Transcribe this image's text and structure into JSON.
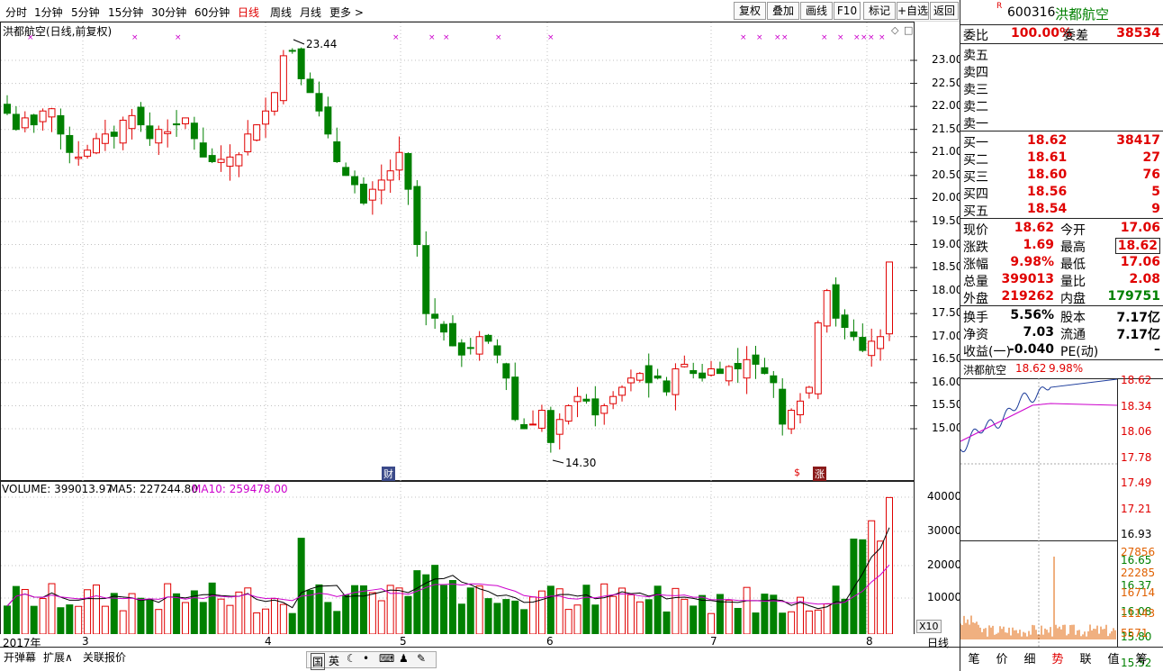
{
  "toolbar": {
    "periods": [
      "分时",
      "1分钟",
      "5分钟",
      "15分钟",
      "30分钟",
      "60分钟",
      "日线",
      "周线",
      "月线",
      "更多 >"
    ],
    "active_period": "日线",
    "buttons": [
      "复权",
      "叠加",
      "画线",
      "F10",
      "标记",
      "+自选",
      "返回"
    ]
  },
  "chart_title": "洪都航空(日线,前复权)",
  "price_axis": [
    "23.00",
    "22.50",
    "22.00",
    "21.50",
    "21.00",
    "20.50",
    "20.00",
    "19.50",
    "19.00",
    "18.50",
    "18.00",
    "17.50",
    "17.00",
    "16.50",
    "16.00",
    "15.50",
    "15.00"
  ],
  "high_marker": "23.44",
  "low_marker": "14.30",
  "event_labels": [
    "财",
    "$",
    "涨"
  ],
  "volume_header": {
    "volume": "VOLUME: 399013.97",
    "ma5": "MA5: 227244.80",
    "ma10": "MA10: 259478.00"
  },
  "volume_axis": [
    "40000",
    "30000",
    "20000",
    "10000"
  ],
  "volume_scale": "X10",
  "date_axis": [
    "2017年",
    "3",
    "4",
    "5",
    "6",
    "7",
    "8"
  ],
  "period_corner": "日线",
  "bottom_tabs": [
    "开弹幕",
    "扩展∧",
    "关联报价"
  ],
  "ime_icons": [
    "国",
    "英"
  ],
  "chart_data": {
    "type": "candlestick",
    "title": "洪都航空(日线,前复权)",
    "x_months": [
      "2017年",
      "3",
      "4",
      "5",
      "6",
      "7",
      "8"
    ],
    "ylim": [
      14.3,
      23.44
    ],
    "closes": [
      21.85,
      21.5,
      21.75,
      21.6,
      21.9,
      21.95,
      21.4,
      21.0,
      20.9,
      21.05,
      21.3,
      21.4,
      21.35,
      21.7,
      21.8,
      21.6,
      21.3,
      21.5,
      21.45,
      21.6,
      21.75,
      21.3,
      20.9,
      20.8,
      20.85,
      20.9,
      20.95,
      21.4,
      21.6,
      21.9,
      22.3,
      23.1,
      23.2,
      22.6,
      22.3,
      21.9,
      21.4,
      20.8,
      20.5,
      20.3,
      19.9,
      20.2,
      20.4,
      20.6,
      21.0,
      20.2,
      19.0,
      17.5,
      17.4,
      17.1,
      16.8,
      16.6,
      16.75,
      17.0,
      16.9,
      16.6,
      16.1,
      15.2,
      15.0,
      15.1,
      15.4,
      14.7,
      15.2,
      15.5,
      15.7,
      15.6,
      15.3,
      15.5,
      15.7,
      15.9,
      16.1,
      16.2,
      16.0,
      16.1,
      15.8,
      16.3,
      16.4,
      16.2,
      16.1,
      16.3,
      16.2,
      16.35,
      16.3,
      16.5,
      16.4,
      16.2,
      16.0,
      15.1,
      15.4,
      15.6,
      15.9,
      17.3,
      18.0,
      17.4,
      17.2,
      17.0,
      16.7,
      16.9,
      17.0,
      18.62
    ],
    "volume_ma_lines": [
      "MA5",
      "MA10"
    ],
    "volume_last": 399013.97,
    "volume_ma5": 227244.8,
    "volume_ma10": 259478.0
  },
  "intraday_mini": {
    "header": "洪都航空",
    "price": "18.62",
    "pct": "9.98%",
    "price_axis": [
      "18.62",
      "18.34",
      "18.06",
      "17.78",
      "17.49",
      "17.21",
      "16.93",
      "16.65",
      "16.37",
      "16.08",
      "15.80",
      "15.52"
    ],
    "volume_axis": [
      "27856",
      "22285",
      "16714",
      "11143",
      "5571"
    ]
  },
  "stock": {
    "badge": "R",
    "code": "600316",
    "name": "洪都航空"
  },
  "quote": {
    "committee_ratio_label": "委比",
    "committee_ratio": "100.00%",
    "committee_diff_label": "委差",
    "committee_diff": "38534",
    "asks": [
      {
        "label": "卖五",
        "price": "",
        "vol": ""
      },
      {
        "label": "卖四",
        "price": "",
        "vol": ""
      },
      {
        "label": "卖三",
        "price": "",
        "vol": ""
      },
      {
        "label": "卖二",
        "price": "",
        "vol": ""
      },
      {
        "label": "卖一",
        "price": "",
        "vol": ""
      }
    ],
    "bids": [
      {
        "label": "买一",
        "price": "18.62",
        "vol": "38417"
      },
      {
        "label": "买二",
        "price": "18.61",
        "vol": "27"
      },
      {
        "label": "买三",
        "price": "18.60",
        "vol": "76"
      },
      {
        "label": "买四",
        "price": "18.56",
        "vol": "5"
      },
      {
        "label": "买五",
        "price": "18.54",
        "vol": "9"
      }
    ],
    "stats": [
      {
        "l1": "现价",
        "v1": "18.62",
        "l2": "今开",
        "v2": "17.06"
      },
      {
        "l1": "涨跌",
        "v1": "1.69",
        "l2": "最高",
        "v2": "18.62"
      },
      {
        "l1": "涨幅",
        "v1": "9.98%",
        "l2": "最低",
        "v2": "17.06"
      },
      {
        "l1": "总量",
        "v1": "399013",
        "l2": "量比",
        "v2": "2.08"
      },
      {
        "l1": "外盘",
        "v1": "219262",
        "l2": "内盘",
        "v2": "179751"
      }
    ],
    "fundamentals": [
      {
        "l1": "换手",
        "v1": "5.56%",
        "l2": "股本",
        "v2": "7.17亿"
      },
      {
        "l1": "净资",
        "v1": "7.03",
        "l2": "流通",
        "v2": "7.17亿"
      },
      {
        "l1": "收益(一)",
        "v1": "-0.040",
        "l2": "PE(动)",
        "v2": "–"
      }
    ]
  },
  "right_tabs": [
    "笔",
    "价",
    "细",
    "势",
    "联",
    "值",
    "筹"
  ],
  "right_active_tab": "势",
  "colors": {
    "up": "#e00000",
    "down": "#008000",
    "ma5": "#000000",
    "ma10": "#cc00cc",
    "grid": "#c0c0c0"
  }
}
